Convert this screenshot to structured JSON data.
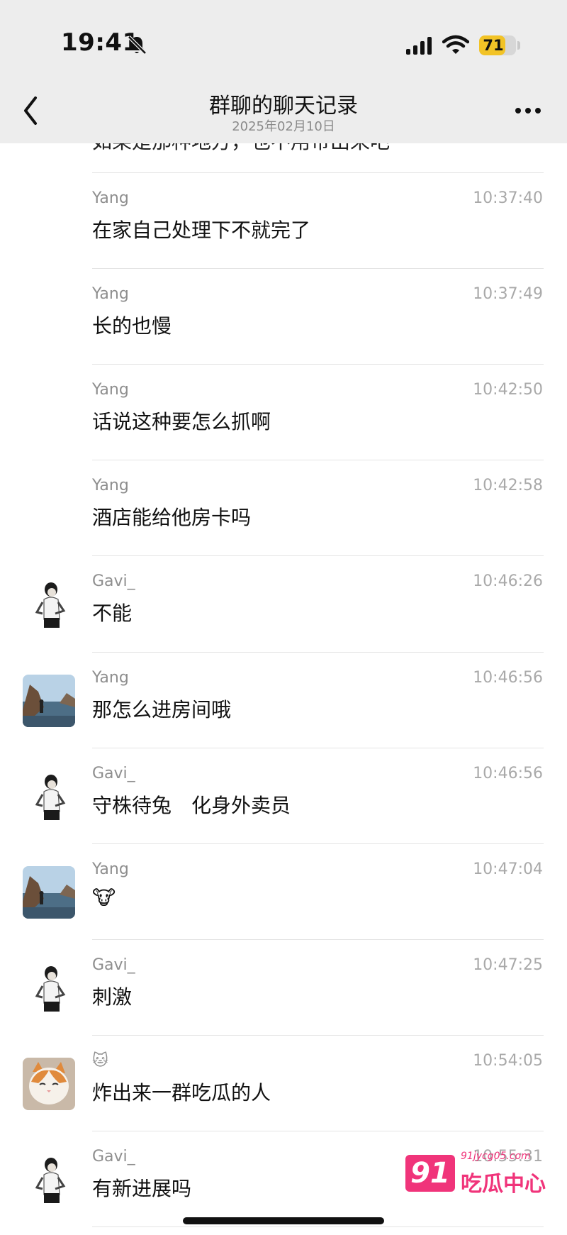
{
  "status_bar": {
    "time": "19:41",
    "battery": "71",
    "battery_level": 0.71
  },
  "header": {
    "title": "群聊的聊天记录",
    "date": "2025年02月10日"
  },
  "partial_message": "如果是那种地方，也不用带出来吧",
  "messages": [
    {
      "sender": "Yang",
      "time": "10:37:40",
      "text": "在家自己处理下不就完了",
      "avatar": "none"
    },
    {
      "sender": "Yang",
      "time": "10:37:49",
      "text": "长的也慢",
      "avatar": "none"
    },
    {
      "sender": "Yang",
      "time": "10:42:50",
      "text": "话说这种要怎么抓啊",
      "avatar": "none"
    },
    {
      "sender": "Yang",
      "time": "10:42:58",
      "text": "酒店能给他房卡吗",
      "avatar": "none"
    },
    {
      "sender": "Gavi_",
      "time": "10:46:26",
      "text": "不能",
      "avatar": "person"
    },
    {
      "sender": "Yang",
      "time": "10:46:56",
      "text": "那怎么进房间哦",
      "avatar": "landscape"
    },
    {
      "sender": "Gavi_",
      "time": "10:46:56",
      "text": "守株待兔　化身外卖员",
      "avatar": "person"
    },
    {
      "sender": "Yang",
      "time": "10:47:04",
      "text": "🐮",
      "avatar": "landscape"
    },
    {
      "sender": "Gavi_",
      "time": "10:47:25",
      "text": "刺激",
      "avatar": "person"
    },
    {
      "sender": "🐱",
      "time": "10:54:05",
      "text": "炸出来一群吃瓜的人",
      "avatar": "cat"
    },
    {
      "sender": "Gavi_",
      "time": "10:55:31",
      "text": "有新进展吗",
      "avatar": "person"
    }
  ],
  "watermark": {
    "logo": "91",
    "url": "91jycg05.com",
    "name": "吃瓜中心"
  },
  "colors": {
    "header_bg": "#ededed",
    "divider": "#e4e4e4",
    "battery": "#f2c326",
    "watermark": "#f0347a"
  }
}
